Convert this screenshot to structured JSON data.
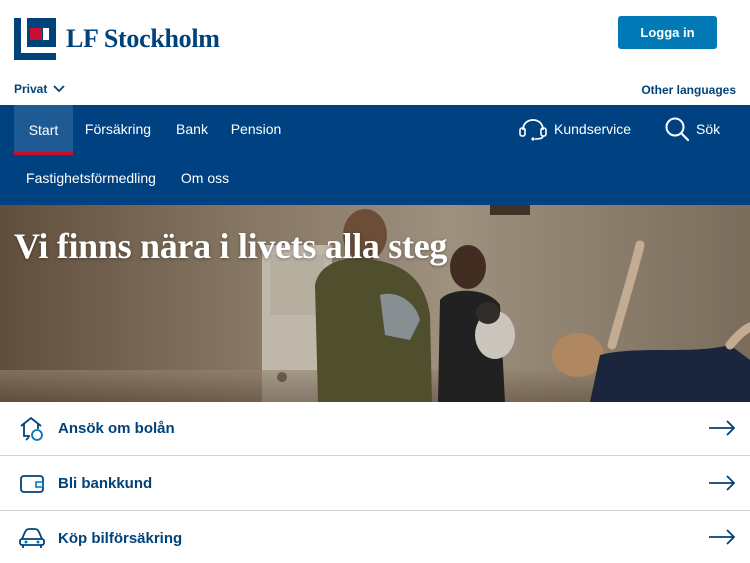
{
  "brand": {
    "name": "LF Stockholm"
  },
  "header": {
    "login_label": "Logga in",
    "segment_label": "Privat",
    "other_languages": "Other languages"
  },
  "nav": {
    "items": [
      {
        "label": "Start",
        "active": true
      },
      {
        "label": "Försäkring"
      },
      {
        "label": "Bank"
      },
      {
        "label": "Pension"
      },
      {
        "label": "Fastighetsförmedling"
      },
      {
        "label": "Om oss"
      }
    ],
    "customer_service": "Kundservice",
    "search": "Sök"
  },
  "hero": {
    "title": "Vi finns nära i livets alla steg"
  },
  "quick_links": [
    {
      "label": "Ansök om bolån",
      "icon": "house-loan-icon"
    },
    {
      "label": "Bli bankkund",
      "icon": "wallet-icon"
    },
    {
      "label": "Köp bilförsäkring",
      "icon": "car-icon"
    }
  ],
  "colors": {
    "brand_blue": "#00427a",
    "nav_blue": "#004281",
    "button_blue": "#0079b6",
    "accent_red": "#c8102e"
  }
}
